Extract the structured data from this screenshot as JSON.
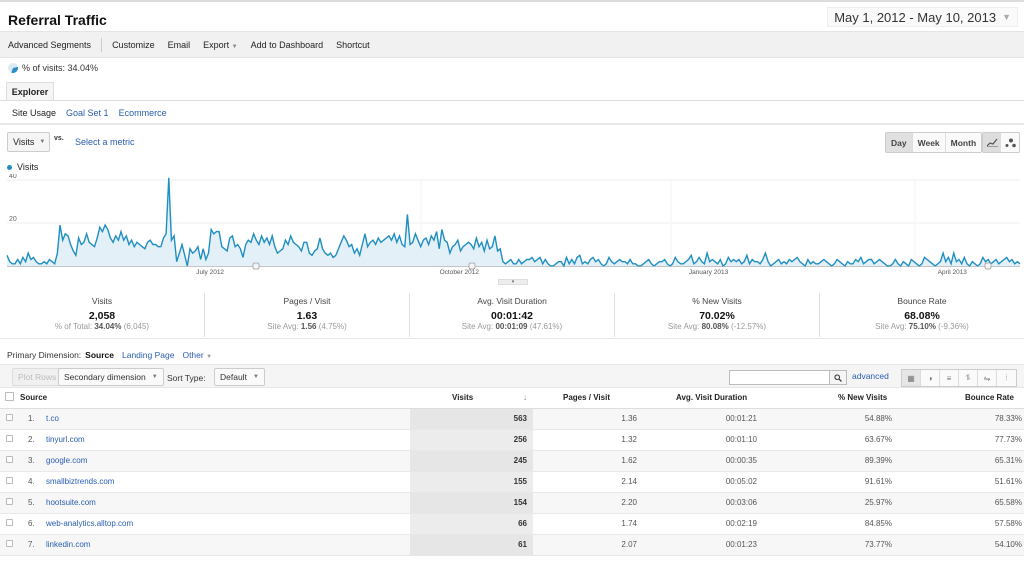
{
  "header": {
    "title": "Referral Traffic",
    "date_range": "May 1, 2012 - May 10, 2013"
  },
  "toolbar": {
    "items": [
      "Advanced Segments",
      "Customize",
      "Email",
      "Export",
      "Add to Dashboard",
      "Shortcut"
    ]
  },
  "segment": {
    "label": "% of visits: 34.04%"
  },
  "tabs": {
    "explorer": "Explorer"
  },
  "subtabs": [
    "Site Usage",
    "Goal Set 1",
    "Ecommerce"
  ],
  "chart_controls": {
    "metric": "Visits",
    "vs": "vs.",
    "select_metric": "Select a metric",
    "periods": [
      "Day",
      "Week",
      "Month"
    ],
    "active_period": "Day",
    "chart_types": [
      "line-chart-icon",
      "motion-chart-icon"
    ]
  },
  "chart_data": {
    "type": "area",
    "title": "",
    "legend": [
      "Visits"
    ],
    "legend_position": "top-left",
    "series_color": "#1f8fc1",
    "xlabel": "",
    "ylabel": "",
    "ylim": [
      0,
      40
    ],
    "y_ticks": [
      20,
      40
    ],
    "x_tick_labels": [
      "July 2012",
      "October 2012",
      "January 2013",
      "April 2013"
    ],
    "x_range": [
      "2012-05-01",
      "2013-05-10"
    ],
    "grid": true,
    "series": [
      {
        "name": "Visits",
        "values": [
          5,
          2,
          1,
          1,
          3,
          1,
          4,
          2,
          6,
          3,
          4,
          2,
          1,
          1,
          2,
          1,
          3,
          2,
          1,
          6,
          19,
          12,
          15,
          14,
          10,
          7,
          5,
          13,
          10,
          11,
          15,
          11,
          10,
          9,
          13,
          18,
          16,
          19,
          17,
          13,
          11,
          14,
          12,
          16,
          12,
          14,
          10,
          12,
          9,
          11,
          10,
          9,
          8,
          11,
          12,
          10,
          10,
          9,
          9,
          13,
          15,
          41,
          12,
          14,
          2,
          6,
          10,
          5,
          0,
          8,
          6,
          7,
          9,
          3,
          8,
          3,
          6,
          17,
          15,
          16,
          16,
          9,
          8,
          7,
          13,
          14,
          9,
          10,
          8,
          4,
          10,
          12,
          11,
          15,
          12,
          10,
          14,
          11,
          13,
          10,
          14,
          9,
          6,
          7,
          8,
          12,
          10,
          14,
          11,
          10,
          9,
          7,
          11,
          11,
          6,
          5,
          7,
          8,
          13,
          8,
          6,
          5,
          6,
          4,
          5,
          8,
          11,
          14,
          12,
          9,
          10,
          6,
          8,
          5,
          10,
          15,
          9,
          11,
          12,
          10,
          13,
          11,
          12,
          13,
          14,
          12,
          15,
          11,
          14,
          10,
          9,
          24,
          10,
          11,
          15,
          12,
          9,
          12,
          13,
          10,
          14,
          12,
          16,
          8,
          17,
          12,
          11,
          6,
          9,
          10,
          12,
          7,
          9,
          10,
          11,
          10,
          8,
          13,
          9,
          11,
          7,
          12,
          8,
          9,
          14,
          7,
          8,
          2,
          1,
          2,
          3,
          1,
          1,
          3,
          1,
          2,
          3,
          3,
          4,
          2,
          3,
          4,
          1,
          3,
          1,
          0,
          0,
          1,
          2,
          2,
          0,
          4,
          1,
          3,
          1,
          4,
          5,
          1,
          2,
          1,
          3,
          4,
          2,
          3,
          1,
          0,
          1,
          4,
          2,
          1,
          2,
          3,
          2,
          2,
          1,
          3,
          1,
          1,
          0,
          0,
          1,
          2,
          3,
          1,
          0,
          1,
          2,
          2,
          3,
          1,
          0,
          1,
          4,
          2,
          1,
          1,
          2,
          3,
          5,
          1,
          2,
          4,
          2,
          1,
          6,
          2,
          3,
          2,
          1,
          3,
          0,
          1,
          4,
          2,
          3,
          2,
          3,
          1,
          2,
          5,
          1,
          3,
          2,
          2,
          1,
          3,
          6,
          2,
          0,
          1,
          2,
          3,
          1,
          2,
          1,
          3,
          2,
          3,
          4,
          2,
          1,
          0,
          3,
          1,
          2,
          1,
          1,
          2,
          3,
          2,
          1,
          0,
          1,
          3,
          2,
          1,
          0,
          2,
          1,
          1,
          3,
          2,
          4,
          1,
          2,
          3,
          3,
          1,
          2,
          3,
          2,
          1,
          0,
          0,
          1,
          3,
          1,
          0,
          2,
          1,
          0,
          3,
          2,
          1,
          0,
          1,
          4,
          3,
          2,
          1,
          0,
          1,
          2,
          6,
          2,
          4,
          1,
          6,
          2,
          3,
          1,
          4,
          1,
          0,
          2,
          1,
          0,
          1,
          4,
          2,
          3,
          1,
          2,
          3,
          1,
          2,
          3,
          4,
          2,
          3,
          1,
          2,
          1
        ]
      }
    ]
  },
  "scorecards": [
    {
      "label": "Visits",
      "value": "2,058",
      "sub_prefix": "% of Total:",
      "sub_bold": "34.04%",
      "sub_suffix": "(6,045)"
    },
    {
      "label": "Pages / Visit",
      "value": "1.63",
      "sub_prefix": "Site Avg:",
      "sub_bold": "1.56",
      "sub_suffix": "(4.75%)"
    },
    {
      "label": "Avg. Visit Duration",
      "value": "00:01:42",
      "sub_prefix": "Site Avg:",
      "sub_bold": "00:01:09",
      "sub_suffix": "(47.61%)"
    },
    {
      "label": "% New Visits",
      "value": "70.02%",
      "sub_prefix": "Site Avg:",
      "sub_bold": "80.08%",
      "sub_suffix": "(-12.57%)"
    },
    {
      "label": "Bounce Rate",
      "value": "68.08%",
      "sub_prefix": "Site Avg:",
      "sub_bold": "75.10%",
      "sub_suffix": "(-9.36%)"
    }
  ],
  "primary_dimension": {
    "label": "Primary Dimension:",
    "current": "Source",
    "options": [
      "Landing Page",
      "Other"
    ]
  },
  "table_toolbar": {
    "plot_rows": "Plot Rows",
    "secondary_dimension": "Secondary dimension",
    "sort_type_label": "Sort Type:",
    "sort_type": "Default",
    "search_placeholder": "",
    "advanced": "advanced"
  },
  "table": {
    "columns": [
      "Source",
      "Visits",
      "Pages / Visit",
      "Avg. Visit Duration",
      "% New Visits",
      "Bounce Rate"
    ],
    "rows": [
      {
        "rank": "1.",
        "source": "t.co",
        "visits": "563",
        "pages": "1.36",
        "duration": "00:01:21",
        "new": "54.88%",
        "bounce": "78.33%"
      },
      {
        "rank": "2.",
        "source": "tinyurl.com",
        "visits": "256",
        "pages": "1.32",
        "duration": "00:01:10",
        "new": "63.67%",
        "bounce": "77.73%"
      },
      {
        "rank": "3.",
        "source": "google.com",
        "visits": "245",
        "pages": "1.62",
        "duration": "00:00:35",
        "new": "89.39%",
        "bounce": "65.31%"
      },
      {
        "rank": "4.",
        "source": "smallbiztrends.com",
        "visits": "155",
        "pages": "2.14",
        "duration": "00:05:02",
        "new": "91.61%",
        "bounce": "51.61%"
      },
      {
        "rank": "5.",
        "source": "hootsuite.com",
        "visits": "154",
        "pages": "2.20",
        "duration": "00:03:06",
        "new": "25.97%",
        "bounce": "65.58%"
      },
      {
        "rank": "6.",
        "source": "web-analytics.alltop.com",
        "visits": "66",
        "pages": "1.74",
        "duration": "00:02:19",
        "new": "84.85%",
        "bounce": "57.58%"
      },
      {
        "rank": "7.",
        "source": "linkedin.com",
        "visits": "61",
        "pages": "2.07",
        "duration": "00:01:23",
        "new": "73.77%",
        "bounce": "54.10%"
      }
    ]
  }
}
